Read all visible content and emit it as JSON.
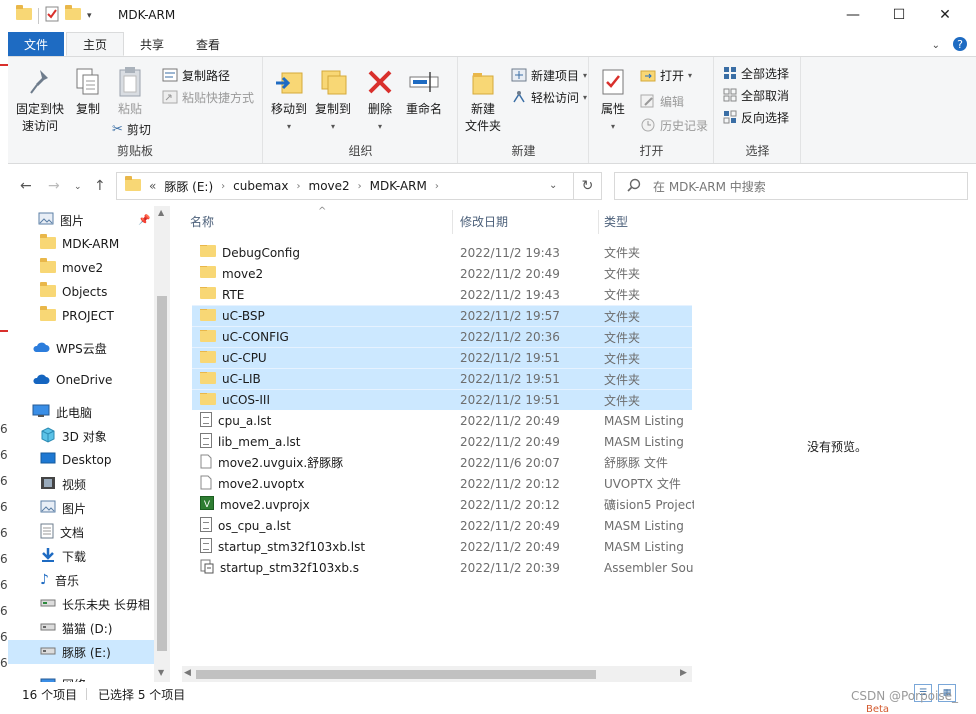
{
  "window": {
    "title": "MDK-ARM",
    "minimize_glyph": "—",
    "maximize_glyph": "☐",
    "close_glyph": "✕"
  },
  "ribbon_tabs": [
    {
      "label": "文件"
    },
    {
      "label": "主页"
    },
    {
      "label": "共享"
    },
    {
      "label": "查看"
    }
  ],
  "ribbon": {
    "clipboard": {
      "pin_label_1": "固定到快",
      "pin_label_2": "速访问",
      "copy_label": "复制",
      "paste_label": "粘贴",
      "copy_path_label": "复制路径",
      "paste_shortcut_label": "粘贴快捷方式",
      "cut_label": "剪切",
      "group_label": "剪贴板"
    },
    "organize": {
      "move_to_label": "移动到",
      "copy_to_label": "复制到",
      "delete_label": "删除",
      "rename_label": "重命名",
      "group_label": "组织"
    },
    "new": {
      "new_folder_label_1": "新建",
      "new_folder_label_2": "文件夹",
      "new_item_label": "新建项目",
      "easy_access_label": "轻松访问",
      "group_label": "新建"
    },
    "open": {
      "properties_label": "属性",
      "open_label": "打开",
      "edit_label": "编辑",
      "history_label": "历史记录",
      "group_label": "打开"
    },
    "select": {
      "select_all_label": "全部选择",
      "select_none_label": "全部取消",
      "invert_label": "反向选择",
      "group_label": "选择"
    }
  },
  "address": {
    "prefix": "«",
    "crumbs": [
      "豚豚 (E:)",
      "cubemax",
      "move2",
      "MDK-ARM"
    ],
    "search_placeholder": "在 MDK-ARM 中搜索"
  },
  "nav_pane": {
    "items": [
      {
        "label": "图片",
        "icon": "pictures-icon"
      },
      {
        "label": "MDK-ARM",
        "icon": "folder-icon"
      },
      {
        "label": "move2",
        "icon": "folder-icon"
      },
      {
        "label": "Objects",
        "icon": "folder-icon"
      },
      {
        "label": "PROJECT",
        "icon": "folder-icon"
      },
      {
        "label": "WPS云盘",
        "icon": "cloud-icon"
      },
      {
        "label": "OneDrive",
        "icon": "cloud-icon"
      },
      {
        "label": "此电脑",
        "icon": "computer-icon"
      },
      {
        "label": "3D 对象",
        "icon": "cube-icon"
      },
      {
        "label": "Desktop",
        "icon": "desktop-icon"
      },
      {
        "label": "视频",
        "icon": "video-icon"
      },
      {
        "label": "图片",
        "icon": "pictures-icon"
      },
      {
        "label": "文档",
        "icon": "documents-icon"
      },
      {
        "label": "下载",
        "icon": "download-icon"
      },
      {
        "label": "音乐",
        "icon": "music-icon"
      },
      {
        "label": "长乐未央    长毋相",
        "icon": "network-drive-icon"
      },
      {
        "label": "猫猫 (D:)",
        "icon": "drive-icon"
      },
      {
        "label": "豚豚 (E:)",
        "icon": "drive-icon"
      },
      {
        "label": "网络",
        "icon": "network-icon"
      }
    ]
  },
  "file_list": {
    "columns": {
      "name": "名称",
      "date": "修改日期",
      "type": "类型"
    },
    "rows": [
      {
        "name": "DebugConfig",
        "date": "2022/11/2 19:43",
        "type": "文件夹",
        "icon": "folder-icon",
        "selected": false
      },
      {
        "name": "move2",
        "date": "2022/11/2 20:49",
        "type": "文件夹",
        "icon": "folder-icon",
        "selected": false
      },
      {
        "name": "RTE",
        "date": "2022/11/2 19:43",
        "type": "文件夹",
        "icon": "folder-icon",
        "selected": false
      },
      {
        "name": "uC-BSP",
        "date": "2022/11/2 19:57",
        "type": "文件夹",
        "icon": "folder-icon",
        "selected": true
      },
      {
        "name": "uC-CONFIG",
        "date": "2022/11/2 20:36",
        "type": "文件夹",
        "icon": "folder-icon",
        "selected": true
      },
      {
        "name": "uC-CPU",
        "date": "2022/11/2 19:51",
        "type": "文件夹",
        "icon": "folder-icon",
        "selected": true
      },
      {
        "name": "uC-LIB",
        "date": "2022/11/2 19:51",
        "type": "文件夹",
        "icon": "folder-icon",
        "selected": true
      },
      {
        "name": "uCOS-III",
        "date": "2022/11/2 19:51",
        "type": "文件夹",
        "icon": "folder-icon",
        "selected": true
      },
      {
        "name": "cpu_a.lst",
        "date": "2022/11/2 20:49",
        "type": "MASM Listing",
        "icon": "document-icon",
        "selected": false
      },
      {
        "name": "lib_mem_a.lst",
        "date": "2022/11/2 20:49",
        "type": "MASM Listing",
        "icon": "document-icon",
        "selected": false
      },
      {
        "name": "move2.uvguix.舒豚豚",
        "date": "2022/11/6 20:07",
        "type": "舒豚豚 文件",
        "icon": "file-icon",
        "selected": false
      },
      {
        "name": "move2.uvoptx",
        "date": "2022/11/2 20:12",
        "type": "UVOPTX 文件",
        "icon": "file-icon",
        "selected": false
      },
      {
        "name": "move2.uvprojx",
        "date": "2022/11/2 20:12",
        "type": "礦ision5 Project",
        "icon": "keil-project-icon",
        "selected": false
      },
      {
        "name": "os_cpu_a.lst",
        "date": "2022/11/2 20:49",
        "type": "MASM Listing",
        "icon": "document-icon",
        "selected": false
      },
      {
        "name": "startup_stm32f103xb.lst",
        "date": "2022/11/2 20:49",
        "type": "MASM Listing",
        "icon": "document-icon",
        "selected": false
      },
      {
        "name": "startup_stm32f103xb.s",
        "date": "2022/11/2 20:39",
        "type": "Assembler Source",
        "icon": "assembler-icon",
        "selected": false
      }
    ]
  },
  "preview": {
    "text": "没有预览。"
  },
  "status": {
    "item_count": "16 个项目",
    "selected_count": "已选择 5 个项目"
  },
  "overlay": {
    "watermark": "CSDN @Porpoise_",
    "beta": "Beta",
    "edge_digit": "6"
  },
  "colors": {
    "file_tab": "#1e6bc2",
    "selection": "#cce8ff",
    "folder": "#f8d775"
  }
}
